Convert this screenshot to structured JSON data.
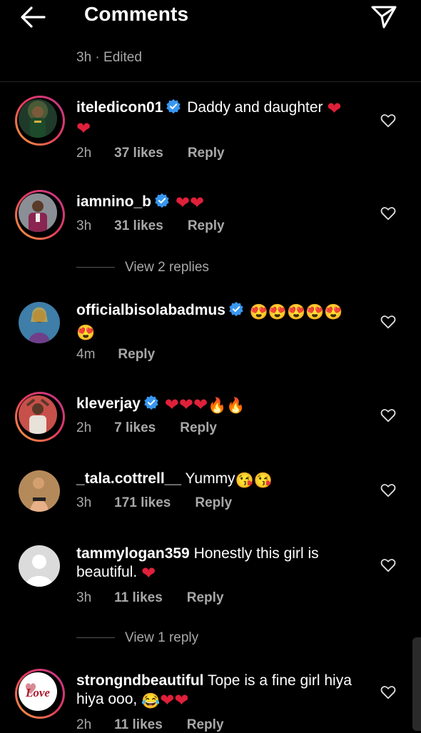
{
  "header": {
    "title": "Comments"
  },
  "top_meta": "3h · Edited",
  "comments": [
    {
      "username": "iteledicon01",
      "verified": true,
      "text": "Daddy and daughter ",
      "emojis": [
        "❤",
        "❤"
      ],
      "time": "2h",
      "likes": "37 likes",
      "reply": "Reply"
    },
    {
      "username": "iamnino_b",
      "verified": true,
      "text": "",
      "emojis": [
        "❤",
        "❤"
      ],
      "time": "3h",
      "likes": "31 likes",
      "reply": "Reply",
      "view_replies": "View 2 replies"
    },
    {
      "username": "officialbisolabadmus",
      "verified": true,
      "text": "",
      "emojis": [
        "😍",
        "😍",
        "😍",
        "😍",
        "😍",
        "😍"
      ],
      "time": "4m",
      "likes": "",
      "reply": "Reply"
    },
    {
      "username": "kleverjay",
      "verified": true,
      "text": "",
      "emojis": [
        "❤",
        "❤",
        "❤",
        "🔥",
        "🔥"
      ],
      "time": "2h",
      "likes": "7 likes",
      "reply": "Reply"
    },
    {
      "username": "_tala.cottrell__",
      "verified": false,
      "text": "Yummy",
      "emojis": [
        "😘",
        "😘"
      ],
      "time": "3h",
      "likes": "171 likes",
      "reply": "Reply"
    },
    {
      "username": "tammylogan359",
      "verified": false,
      "text": "Honestly this girl is beautiful. ",
      "emojis": [
        "❤"
      ],
      "time": "3h",
      "likes": "11 likes",
      "reply": "Reply",
      "view_replies": "View 1 reply"
    },
    {
      "username": "strongndbeautiful",
      "verified": false,
      "text": "Tope is a fine girl hiya hiya ooo, ",
      "emojis": [
        "😂",
        "❤",
        "❤"
      ],
      "time": "2h",
      "likes": "11 likes",
      "reply": "Reply"
    }
  ],
  "avatar_logo_text": "Love",
  "colors": {
    "background": "#000000",
    "secondary_text": "#a8a8a8",
    "verified": "#3897f0",
    "heart_red": "#e0203a"
  }
}
